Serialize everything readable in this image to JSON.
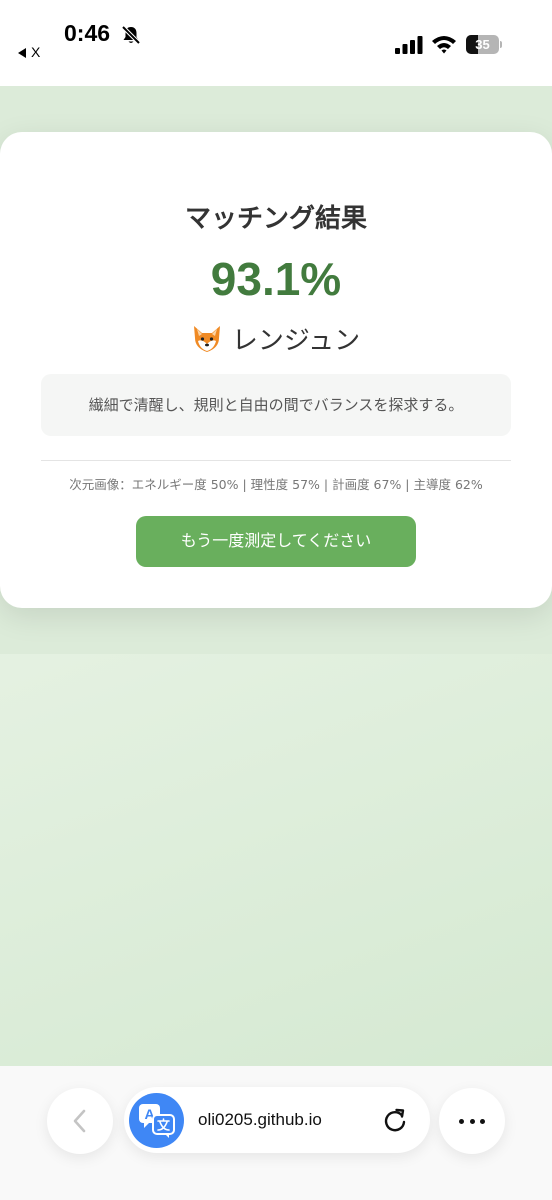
{
  "status_bar": {
    "time": "0:46",
    "back_app": "X",
    "battery_percent": "35",
    "battery_level": 0.35
  },
  "result": {
    "title": "マッチング結果",
    "score": "93.1%",
    "match_name": "レンジュン",
    "match_emoji": "fox-icon",
    "description": "繊細で清醒し、規則と自由の間でバランスを探求する。",
    "dimensions": "次元画像：エネルギー度 50% | 理性度 57% | 計画度 67% | 主導度 62%",
    "retry_label": "もう一度測定してください"
  },
  "browser": {
    "url": "oli0205.github.io"
  },
  "colors": {
    "accent_green": "#69af5d",
    "score_green": "#427b3e",
    "translate_blue": "#3f87f5"
  }
}
